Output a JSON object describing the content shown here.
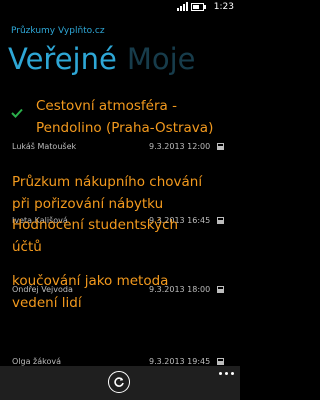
{
  "status": {
    "time": "1:23"
  },
  "app": {
    "title": "Průzkumy Vyplňto.cz"
  },
  "pivot": {
    "active": "Veřejné",
    "inactive": "Moje"
  },
  "items": [
    {
      "title": "Cestovní atmosféra -\nPendolino (Praha-Ostrava)",
      "author": "Lukáš Matoušek",
      "date": "9.3.2013 12:00",
      "completed": true
    },
    {
      "title": "Průzkum nákupního chování\npři pořizování nábytku",
      "author": "Iveta Kališová",
      "date": "9.3.2013 16:45",
      "completed": false
    },
    {
      "title": "Hodnocení studentských\núčtů",
      "author": "Ondřej Vejvoda",
      "date": "9.3.2013 18:00",
      "completed": false
    },
    {
      "title": "koučování jako metoda\nvedení lidí",
      "author": "Olga žáková",
      "date": "9.3.2013 19:45",
      "completed": false
    }
  ],
  "appbar": {
    "refresh_icon": "refresh-icon",
    "more_icon": "ellipsis-icon"
  },
  "colors": {
    "accent": "#2ea7d6",
    "item_title": "#f39a1e",
    "check": "#2bb04b"
  }
}
